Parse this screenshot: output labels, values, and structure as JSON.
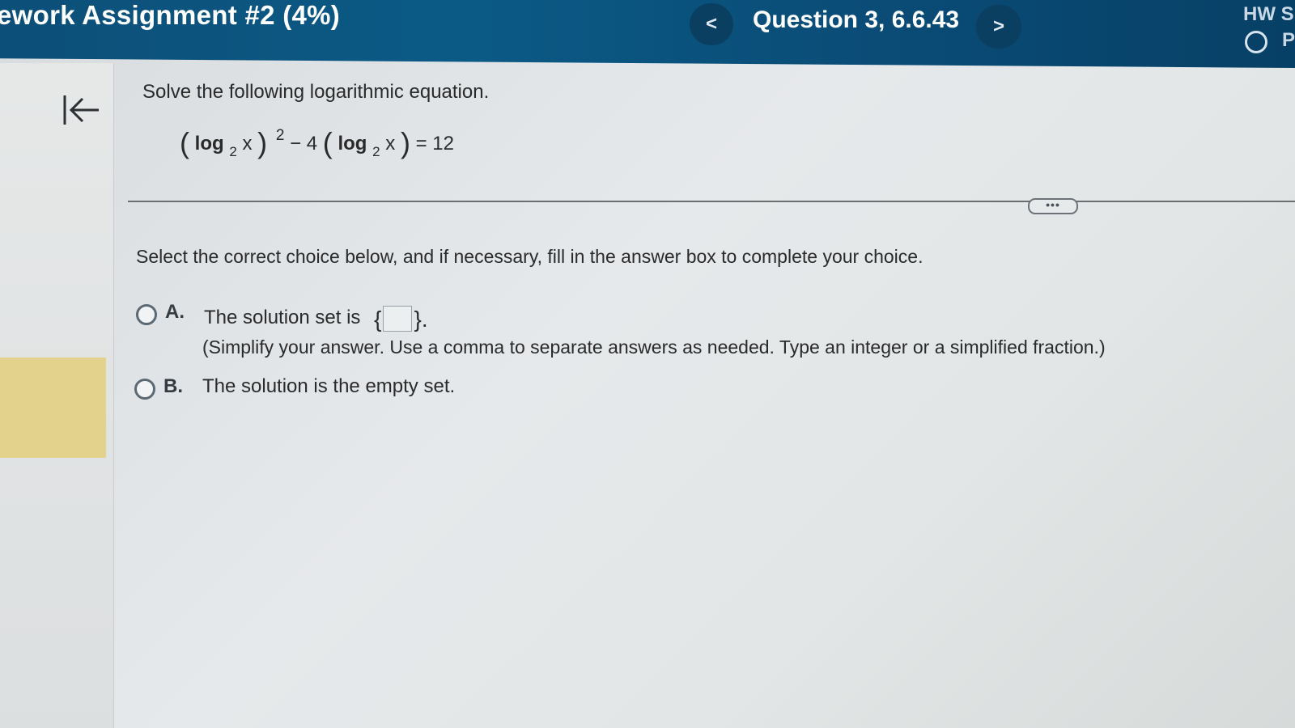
{
  "header": {
    "assignment_title": "ework Assignment #2 (4%)",
    "prev_label": "<",
    "question_label": "Question 3, 6.6.43",
    "next_label": ">",
    "hw_score_label": "HW S",
    "points_label": "P"
  },
  "question": {
    "prompt": "Solve the following logarithmic equation.",
    "equation": {
      "open1": "(",
      "log1": "log",
      "base1": "2",
      "var1": "x",
      "close1": ")",
      "exponent": "2",
      "minus_coef": "− 4",
      "open2": "(",
      "log2": "log",
      "base2": "2",
      "var2": "x",
      "close2": ")",
      "rhs": "= 12"
    },
    "more_label": "•••",
    "instruction": "Select the correct choice below, and if necessary, fill in the answer box to complete your choice."
  },
  "choices": {
    "a": {
      "letter": "A.",
      "text": "The solution set is",
      "open_brace": "{",
      "close_brace": "}.",
      "answer_value": "",
      "hint": "(Simplify your answer. Use a comma to separate answers as needed. Type an integer or a simplified fraction.)"
    },
    "b": {
      "letter": "B.",
      "text": "The solution is the empty set."
    }
  },
  "colors": {
    "header": "#0b5a86",
    "rail_highlight": "#e3d28c"
  }
}
